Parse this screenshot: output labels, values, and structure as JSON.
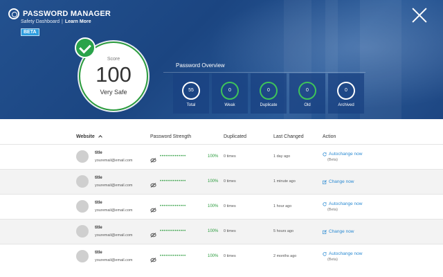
{
  "header": {
    "brand_title": "PASSWORD MANAGER",
    "subtitle": "Safety Dashboard",
    "separator": "|",
    "learn_more": "Learn More",
    "beta_badge": "BETA"
  },
  "score": {
    "label": "Score",
    "value": "100",
    "status": "Very Safe"
  },
  "overview": {
    "title": "Password Overview",
    "cards": [
      {
        "value": "55",
        "label": "Total",
        "ring": "white"
      },
      {
        "value": "0",
        "label": "Weak",
        "ring": "green"
      },
      {
        "value": "0",
        "label": "Duplicate",
        "ring": "green"
      },
      {
        "value": "0",
        "label": "Old",
        "ring": "green"
      },
      {
        "value": "0",
        "label": "Archived",
        "ring": "white"
      }
    ]
  },
  "table": {
    "headers": {
      "website": "Website",
      "strength": "Password Strength",
      "duplicated": "Duplicated",
      "last_changed": "Last Changed",
      "action": "Action"
    },
    "rows": [
      {
        "title": "title",
        "email": "youremail@email.com",
        "strength_dots": "••••••••••••••",
        "strength_pct": "100%",
        "duplicated": "0 times",
        "last_changed": "1 day ago",
        "action": "Autochange now",
        "action_note": "(Beta)",
        "action_icon": "refresh-icon"
      },
      {
        "title": "title",
        "email": "youremail@email.com",
        "strength_dots": "••••••••••••••",
        "strength_pct": "100%",
        "duplicated": "0 times",
        "last_changed": "1 minute ago",
        "action": "Change now",
        "action_note": "",
        "action_icon": "edit-icon"
      },
      {
        "title": "title",
        "email": "youremail@email.com",
        "strength_dots": "••••••••••••••",
        "strength_pct": "100%",
        "duplicated": "0 times",
        "last_changed": "1 hour ago",
        "action": "Autochange now",
        "action_note": "(Beta)",
        "action_icon": "refresh-icon"
      },
      {
        "title": "title",
        "email": "youremail@email.com",
        "strength_dots": "••••••••••••••",
        "strength_pct": "100%",
        "duplicated": "0 times",
        "last_changed": "5 hours ago",
        "action": "Change now",
        "action_note": "",
        "action_icon": "edit-icon"
      },
      {
        "title": "title",
        "email": "youremail@email.com",
        "strength_dots": "••••••••••••••",
        "strength_pct": "100%",
        "duplicated": "0 times",
        "last_changed": "2 months ago",
        "action": "Autochange now",
        "action_note": "(Beta)",
        "action_icon": "refresh-icon"
      }
    ]
  },
  "colors": {
    "header_blue": "#1b4581",
    "accent_green": "#2a9b3c",
    "link_blue": "#2b8ad2",
    "beta_blue": "#2f9ee0"
  }
}
